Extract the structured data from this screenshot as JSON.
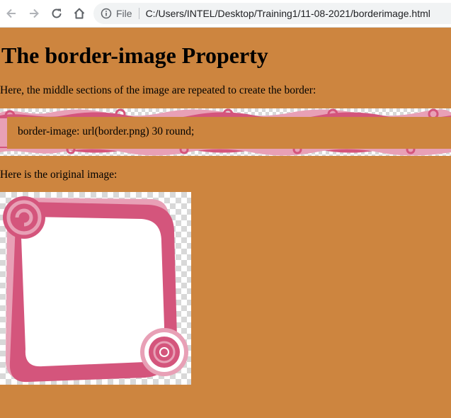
{
  "browser": {
    "scheme_label": "File",
    "url": "C:/Users/INTEL/Desktop/Training1/11-08-2021/borderimage.html"
  },
  "page": {
    "heading": "The border-image Property",
    "intro": "Here, the middle sections of the image are repeated to create the border:",
    "demo_text": "border-image: url(border.png) 30 round;",
    "original_label": "Here is the original image:"
  },
  "colors": {
    "page_background": "#cd853f",
    "frame_pink": "#d4557c",
    "frame_light_pink": "#e8a0b6"
  }
}
